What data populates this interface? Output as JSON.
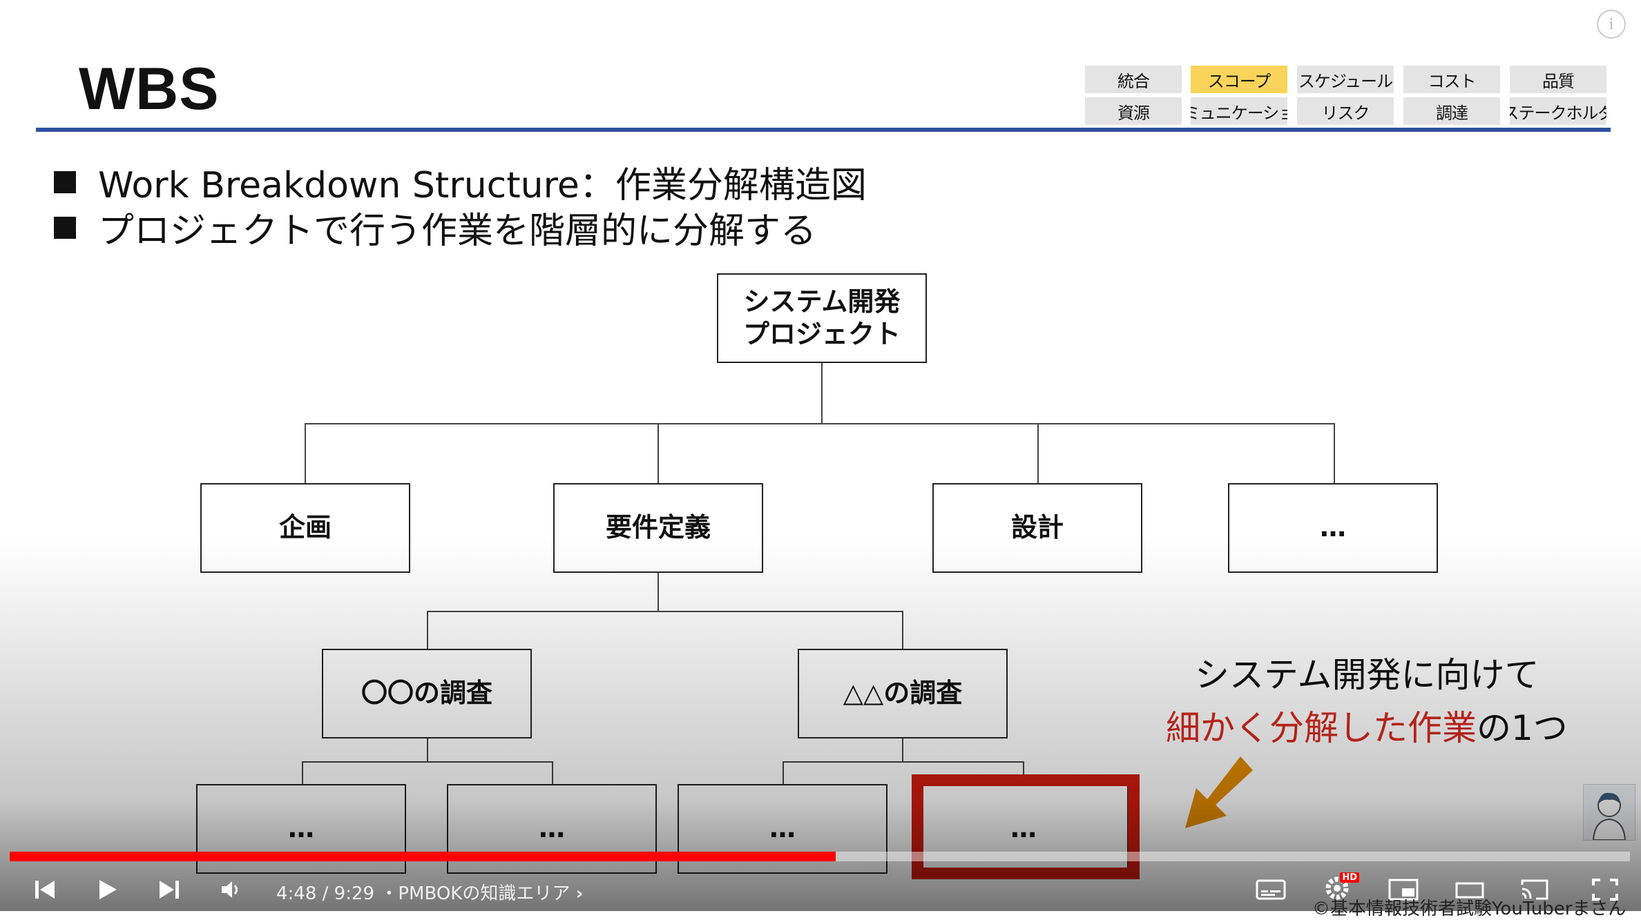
{
  "slide": {
    "title": "WBS",
    "pmbok_tabs": {
      "row1": [
        "統合",
        "スコープ",
        "スケジュール",
        "コスト",
        "品質"
      ],
      "row2": [
        "資源",
        "コミュニケーション",
        "リスク",
        "調達",
        "ステークホルダ"
      ],
      "active": "スコープ"
    },
    "bullets": [
      "Work Breakdown Structure：作業分解構造図",
      "プロジェクトで行う作業を階層的に分解する"
    ],
    "wbs": {
      "root": "システム開発\nプロジェクト",
      "level1": [
        "企画",
        "要件定義",
        "設計",
        "…"
      ],
      "level2": [
        "〇〇の調査",
        "△△の調査"
      ],
      "level3": [
        "…",
        "…",
        "…",
        "…"
      ]
    },
    "annotation": {
      "line1": "システム開発に向けて",
      "line2_red": "細かく分解した作業",
      "line2_rest": "の1つ"
    },
    "watermark": "©基本情報技術者試験YouTuberまさん"
  },
  "player": {
    "time": "4:48 / 9:29",
    "separator": "・",
    "chapter": "PMBOKの知識エリア",
    "progress_played": 0.51,
    "hd_badge": "HD",
    "colors": {
      "played": "#ff0000",
      "highlight": "#cf1b0e",
      "scope_tab": "#fad45a",
      "rule": "#2d4f9e"
    }
  },
  "icons": [
    "info-icon",
    "previous-icon",
    "play-icon",
    "next-icon",
    "volume-icon",
    "subtitles-icon",
    "settings-icon",
    "miniplayer-icon",
    "theater-icon",
    "cast-icon",
    "fullscreen-icon",
    "chevron-right-icon"
  ]
}
